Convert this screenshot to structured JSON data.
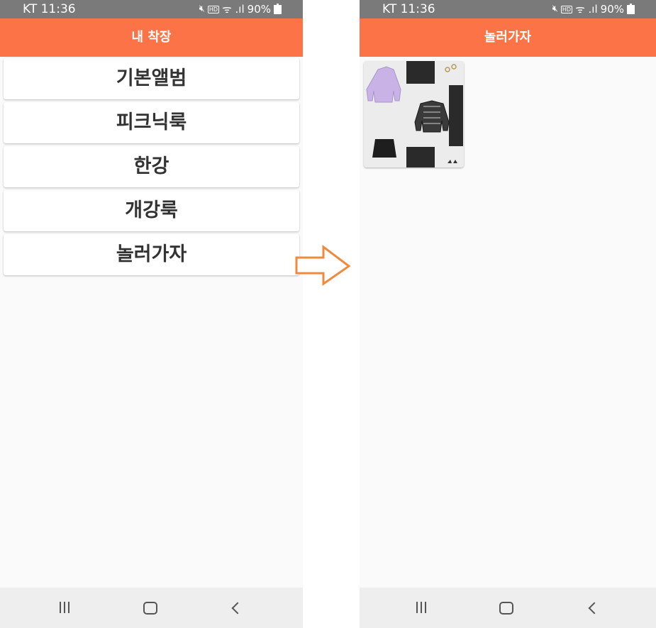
{
  "status_bar": {
    "carrier_time": "KT 11:36",
    "hd_label": "HD",
    "signal_glyphs": "ᯤ .ıl",
    "battery": "90%"
  },
  "left_screen": {
    "title": "내 착장",
    "albums": [
      "기본앨범",
      "피크닉룩",
      "한강",
      "개강룩",
      "놀러가자"
    ]
  },
  "right_screen": {
    "title": "놀러가자",
    "thumbnail_count": 1
  },
  "colors": {
    "appbar": "#fb7347",
    "arrow": "#f08a3c",
    "statusbar": "#7a7a7a"
  },
  "icons": [
    "mute-icon",
    "hd-icon",
    "wifi-icon",
    "signal-icon",
    "battery-icon",
    "recent-apps-icon",
    "home-icon",
    "back-icon",
    "right-arrow-icon"
  ]
}
